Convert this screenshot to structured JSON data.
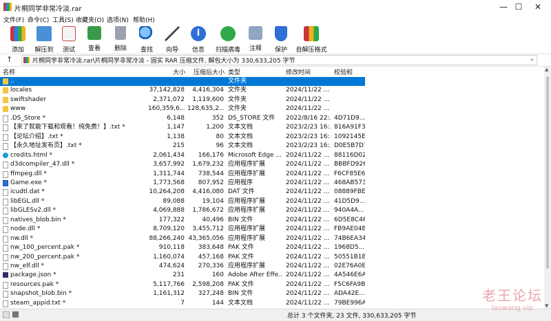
{
  "window": {
    "title": "片桐同学非常冷淡.rar",
    "minimize": "—",
    "maximize": "☐",
    "close": "✕"
  },
  "menu": [
    "文件(F)",
    "命令(C)",
    "工具(S)",
    "收藏夹(O)",
    "选项(N)",
    "帮助(H)"
  ],
  "toolbar": [
    {
      "label": "添加",
      "icon": "add-books-icon"
    },
    {
      "label": "解压到",
      "icon": "extract-folder-icon"
    },
    {
      "label": "测试",
      "icon": "test-clipboard-icon"
    },
    {
      "label": "查看",
      "icon": "view-book-icon"
    },
    {
      "label": "删除",
      "icon": "trash-icon"
    },
    {
      "label": "查找",
      "icon": "magnifier-icon"
    },
    {
      "label": "向导",
      "icon": "wand-icon"
    },
    {
      "label": "信息",
      "icon": "info-icon"
    },
    {
      "label": "扫描病毒",
      "icon": "bug-icon"
    },
    {
      "label": "注释",
      "icon": "comment-icon"
    },
    {
      "label": "保护",
      "icon": "shield-icon"
    },
    {
      "label": "自解压格式",
      "icon": "sfx-icon"
    }
  ],
  "address": {
    "path": "片桐同学非常冷淡.rar\\片桐同学非常冷淡 - 固实 RAR 压缩文件, 解包大小为 330,633,205 字节"
  },
  "columns": {
    "name": "名称",
    "size": "大小",
    "packed": "压缩后大小",
    "type": "类型",
    "modified": "修改时间",
    "crc": "校验和"
  },
  "files": [
    {
      "icon": "folder",
      "name": "..",
      "size": "",
      "packed": "",
      "type": "文件夹",
      "modified": "",
      "crc": "",
      "selected": true
    },
    {
      "icon": "folder",
      "name": "locales",
      "size": "37,142,828",
      "packed": "4,416,304",
      "type": "文件夹",
      "modified": "2024/11/22 ...",
      "crc": ""
    },
    {
      "icon": "folder",
      "name": "swiftshader",
      "size": "2,371,072",
      "packed": "1,119,600",
      "type": "文件夹",
      "modified": "2024/11/22 ...",
      "crc": ""
    },
    {
      "icon": "folder",
      "name": "www",
      "size": "160,359,6...",
      "packed": "128,635,2...",
      "type": "文件夹",
      "modified": "2024/11/22 ...",
      "crc": ""
    },
    {
      "icon": "file",
      "name": ".DS_Store *",
      "size": "6,148",
      "packed": "352",
      "type": "DS_STORE 文件",
      "modified": "2022/8/16 22:...",
      "crc": "4D71D9..."
    },
    {
      "icon": "file",
      "name": "【来了就能下载和观看！纯免费！】.txt *",
      "size": "1,147",
      "packed": "1,200",
      "type": "文本文档",
      "modified": "2023/2/23 16:...",
      "crc": "816A91F3"
    },
    {
      "icon": "file",
      "name": "【论坛介绍】.txt *",
      "size": "1,138",
      "packed": "80",
      "type": "文本文档",
      "modified": "2023/2/23 16:...",
      "crc": "1092145E"
    },
    {
      "icon": "file",
      "name": "【永久地址发布页】.txt *",
      "size": "215",
      "packed": "96",
      "type": "文本文档",
      "modified": "2023/2/23 16:...",
      "crc": "D0E5B7D7"
    },
    {
      "icon": "edge",
      "name": "credits.html *",
      "size": "2,061,434",
      "packed": "166,176",
      "type": "Microsoft Edge ...",
      "modified": "2024/11/22 ...",
      "crc": "88116D02"
    },
    {
      "icon": "file",
      "name": "d3dcompiler_47.dll *",
      "size": "3,657,992",
      "packed": "1,679,232",
      "type": "应用程序扩展",
      "modified": "2024/11/22 ...",
      "crc": "BBBFD926"
    },
    {
      "icon": "file",
      "name": "ffmpeg.dll *",
      "size": "1,311,744",
      "packed": "738,544",
      "type": "应用程序扩展",
      "modified": "2024/11/22 ...",
      "crc": "F6CF85E6"
    },
    {
      "icon": "exe",
      "name": "Game.exe *",
      "size": "1,773,568",
      "packed": "807,952",
      "type": "应用程序",
      "modified": "2024/11/22 ...",
      "crc": "468AB573"
    },
    {
      "icon": "file",
      "name": "icudtl.dat *",
      "size": "10,264,208",
      "packed": "4,416,080",
      "type": "DAT 文件",
      "modified": "2024/11/22 ...",
      "crc": "08889FBE"
    },
    {
      "icon": "file",
      "name": "libEGL.dll *",
      "size": "89,088",
      "packed": "19,104",
      "type": "应用程序扩展",
      "modified": "2024/11/22 ...",
      "crc": "41D5D9..."
    },
    {
      "icon": "file",
      "name": "libGLESv2.dll *",
      "size": "4,069,888",
      "packed": "1,786,672",
      "type": "应用程序扩展",
      "modified": "2024/11/22 ...",
      "crc": "940A4A..."
    },
    {
      "icon": "file",
      "name": "natives_blob.bin *",
      "size": "177,322",
      "packed": "40,496",
      "type": "BIN 文件",
      "modified": "2024/11/22 ...",
      "crc": "6D5E8C46"
    },
    {
      "icon": "file",
      "name": "node.dll *",
      "size": "8,709,120",
      "packed": "3,455,712",
      "type": "应用程序扩展",
      "modified": "2024/11/22 ...",
      "crc": "FB9AE04B"
    },
    {
      "icon": "file",
      "name": "nw.dll *",
      "size": "88,266,240",
      "packed": "43,365,056",
      "type": "应用程序扩展",
      "modified": "2024/11/22 ...",
      "crc": "74B6EA34"
    },
    {
      "icon": "file",
      "name": "nw_100_percent.pak *",
      "size": "910,118",
      "packed": "383,648",
      "type": "PAK 文件",
      "modified": "2024/11/22 ...",
      "crc": "1968D5..."
    },
    {
      "icon": "file",
      "name": "nw_200_percent.pak *",
      "size": "1,160,074",
      "packed": "457,168",
      "type": "PAK 文件",
      "modified": "2024/11/22 ...",
      "crc": "50551B1B"
    },
    {
      "icon": "file",
      "name": "nw_elf.dll *",
      "size": "474,624",
      "packed": "270,336",
      "type": "应用程序扩展",
      "modified": "2024/11/22 ...",
      "crc": "02E76A0E"
    },
    {
      "icon": "ae",
      "name": "package.json *",
      "size": "231",
      "packed": "160",
      "type": "Adobe After Effe...",
      "modified": "2024/11/22 ...",
      "crc": "4A546E6A"
    },
    {
      "icon": "file",
      "name": "resources.pak *",
      "size": "5,117,766",
      "packed": "2,598,208",
      "type": "PAK 文件",
      "modified": "2024/11/22 ...",
      "crc": "F5C6FA9B"
    },
    {
      "icon": "file",
      "name": "snapshot_blob.bin *",
      "size": "1,161,312",
      "packed": "327,248",
      "type": "BIN 文件",
      "modified": "2024/11/22 ...",
      "crc": "ADA42E..."
    },
    {
      "icon": "file",
      "name": "steam_appid.txt *",
      "size": "7",
      "packed": "144",
      "type": "文本文档",
      "modified": "2024/11/22 ...",
      "crc": "79BE996A"
    }
  ],
  "status": {
    "text": "总计 3 个文件夹, 23 文件, 330,633,205 字节"
  },
  "watermark": {
    "title": "老王论坛",
    "url": "laowang.vip"
  },
  "colors": {
    "selection": "#0078d7",
    "watermark": "#e8a7ac"
  }
}
